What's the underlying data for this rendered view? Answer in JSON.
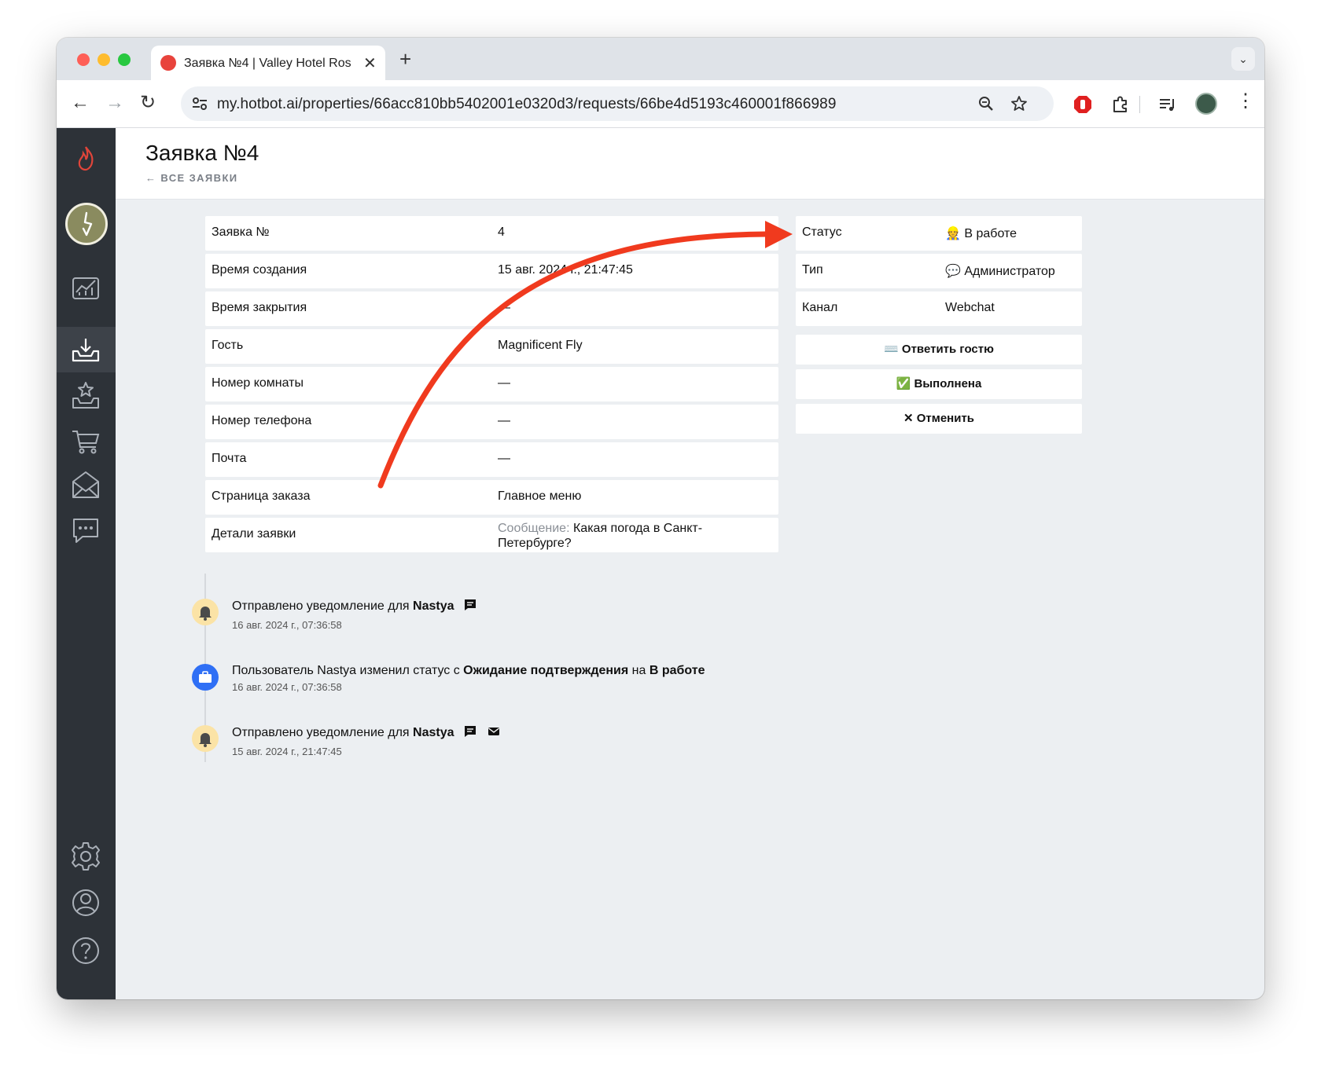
{
  "browser": {
    "tab_title": "Заявка №4 | Valley Hotel Ros",
    "url": "my.hotbot.ai/properties/66acc810bb5402001e0320d3/requests/66be4d5193c460001f866989"
  },
  "page": {
    "title": "Заявка №4",
    "back_link": "← ВСЕ ЗАЯВКИ"
  },
  "details": [
    {
      "label": "Заявка №",
      "value": "4"
    },
    {
      "label": "Время создания",
      "value": "15 авг. 2024 г., 21:47:45"
    },
    {
      "label": "Время закрытия",
      "value": "—"
    },
    {
      "label": "Гость",
      "value": "Magnificent Fly"
    },
    {
      "label": "Номер комнаты",
      "value": "—"
    },
    {
      "label": "Номер телефона",
      "value": "—"
    },
    {
      "label": "Почта",
      "value": "—"
    },
    {
      "label": "Страница заказа",
      "value": "Главное меню"
    },
    {
      "label": "Детали заявки",
      "value_prefix": "Сообщение:",
      "value": "Какая погода в Санкт-Петербурге?"
    }
  ],
  "meta": [
    {
      "label": "Статус",
      "value": "👷 В работе"
    },
    {
      "label": "Тип",
      "value": "💬 Администратор"
    },
    {
      "label": "Канал",
      "value": "Webchat"
    }
  ],
  "actions": {
    "reply": "⌨️ Ответить гостю",
    "done": "✅ Выполнена",
    "cancel": "✕ Отменить"
  },
  "timeline": [
    {
      "prefix": "Отправлено уведомление для ",
      "bold": "Nastya",
      "date": "16 авг. 2024 г., 07:36:58",
      "icon": "bell-icon"
    },
    {
      "prefix": "Пользователь Nastya изменил статус с ",
      "bold": "Ожидание подтверждения",
      "mid": " на ",
      "bold2": "В работе",
      "date": "16 авг. 2024 г., 07:36:58",
      "icon": "briefcase-icon"
    },
    {
      "prefix": "Отправлено уведомление для ",
      "bold": "Nastya",
      "date": "15 авг. 2024 г., 21:47:45",
      "icon": "bell-icon"
    }
  ],
  "colors": {
    "sidebar": "#2d3238",
    "annotation_arrow": "#f03a1e",
    "bell_dot": "#fbe3a6",
    "briefcase_dot": "#2f6ff5"
  }
}
